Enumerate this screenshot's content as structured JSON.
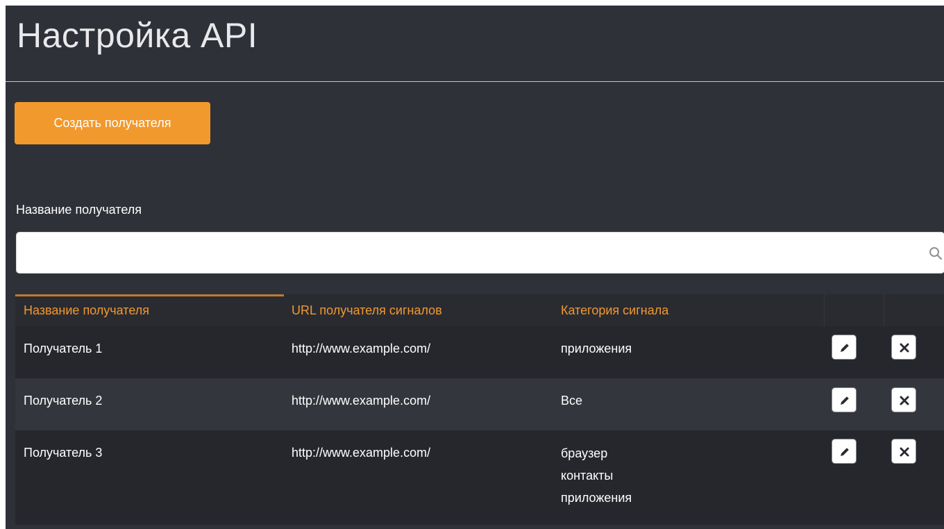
{
  "page": {
    "title": "Настройка API"
  },
  "toolbar": {
    "create_label": "Создать получателя"
  },
  "filter": {
    "label": "Название получателя",
    "placeholder": "",
    "search_icon": "search-icon"
  },
  "table": {
    "headers": [
      "Название получателя",
      "URL получателя сигналов",
      "Категория сигнала"
    ],
    "rows": [
      {
        "name": "Получатель 1",
        "url": "http://www.example.com/",
        "categories": [
          "приложения"
        ]
      },
      {
        "name": "Получатель 2",
        "url": "http://www.example.com/",
        "categories": [
          "Все"
        ]
      },
      {
        "name": "Получатель 3",
        "url": "http://www.example.com/",
        "categories": [
          "браузер",
          "контакты",
          "приложения"
        ]
      }
    ],
    "actions": {
      "edit_icon": "pencil-icon",
      "delete_icon": "close-icon"
    }
  },
  "colors": {
    "accent": "#f2992e",
    "panel_background": "#2f3139",
    "header_text": "#f2992e",
    "row_odd": "#26272d",
    "row_even": "#34363d"
  }
}
